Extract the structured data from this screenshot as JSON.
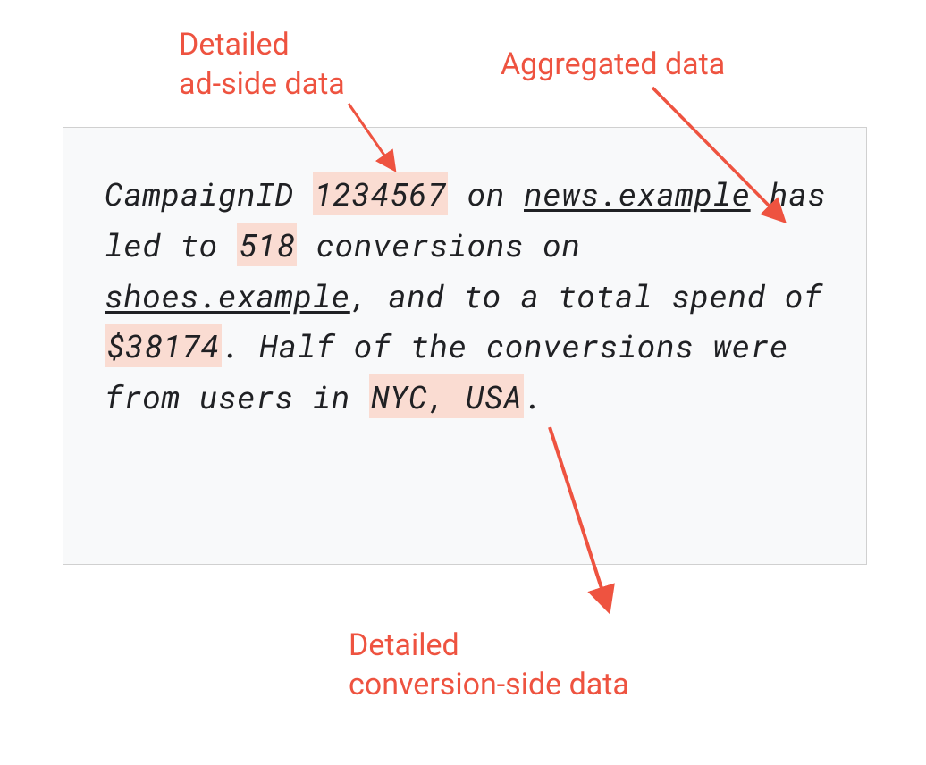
{
  "labels": {
    "topLeft": {
      "line1": "Detailed",
      "line2": "ad-side data"
    },
    "topRight": "Aggregated data",
    "bottom": {
      "line1": "Detailed",
      "line2": "conversion-side data"
    }
  },
  "content": {
    "prefix1": "CampaignID ",
    "campaignId": "1234567",
    "after1": " on ",
    "domain1": "news.example",
    "after2": " has led to ",
    "conversions": "518",
    "after3": " conversions on ",
    "domain2": "shoes.example",
    "after4": ", and to a total spend of ",
    "spend": "$38174",
    "after5": ". Half of the conversions were from users in ",
    "location": "NYC, USA",
    "after6": "."
  },
  "colors": {
    "accent": "#ee5340",
    "highlight": "#fadcd2",
    "boxBg": "#f8f9fa",
    "boxBorder": "#d0d0d0",
    "text": "#202124"
  }
}
